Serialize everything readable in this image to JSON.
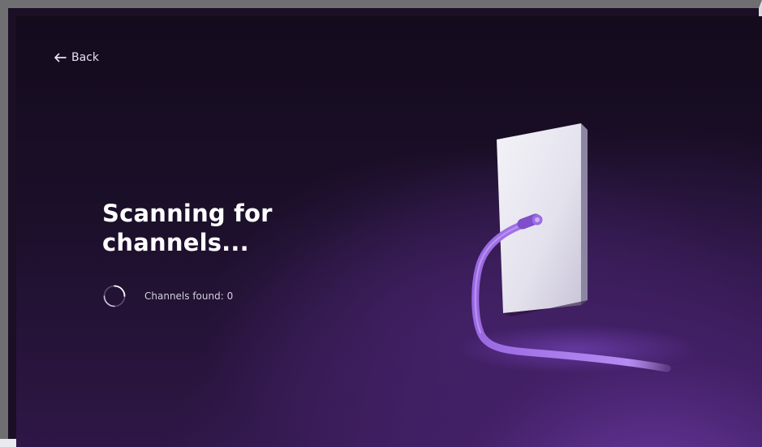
{
  "header": {
    "back_label": "Back"
  },
  "scan": {
    "title_line1": "Scanning for",
    "title_line2": "channels...",
    "status_text": "Channels found: 0"
  },
  "icons": {
    "back": "arrow-left-icon",
    "spinner": "loading-spinner-icon",
    "illustration": "antenna-cable-wall-outlet-illustration"
  },
  "colors": {
    "background": "#1b0f29",
    "accent": "#8a57d6",
    "text": "#ffffff"
  }
}
